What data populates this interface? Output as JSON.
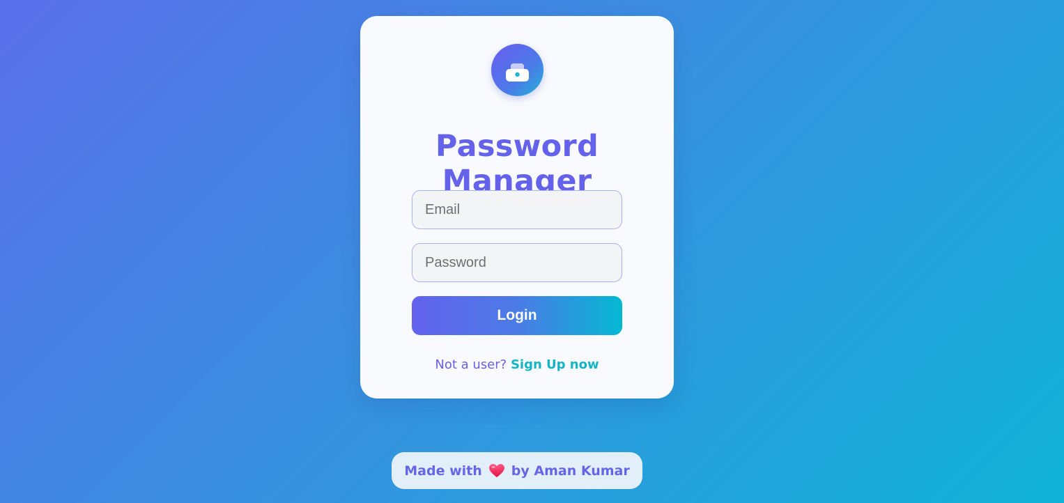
{
  "app": {
    "title": "Password Manager",
    "logo_icon": "toolbox-icon"
  },
  "form": {
    "email_placeholder": "Email",
    "email_value": "",
    "password_placeholder": "Password",
    "password_value": "",
    "login_label": "Login"
  },
  "signup": {
    "prefix": "Not a user?",
    "link_label": "Sign Up now"
  },
  "footer": {
    "made_with": "Made with",
    "heart_icon": "heart-icon",
    "by_author": "by Aman Kumar"
  },
  "colors": {
    "accent": "#6462ea",
    "link": "#12b4c6",
    "button_gradient_start": "#6262ec",
    "button_gradient_end": "#05b8d2"
  }
}
